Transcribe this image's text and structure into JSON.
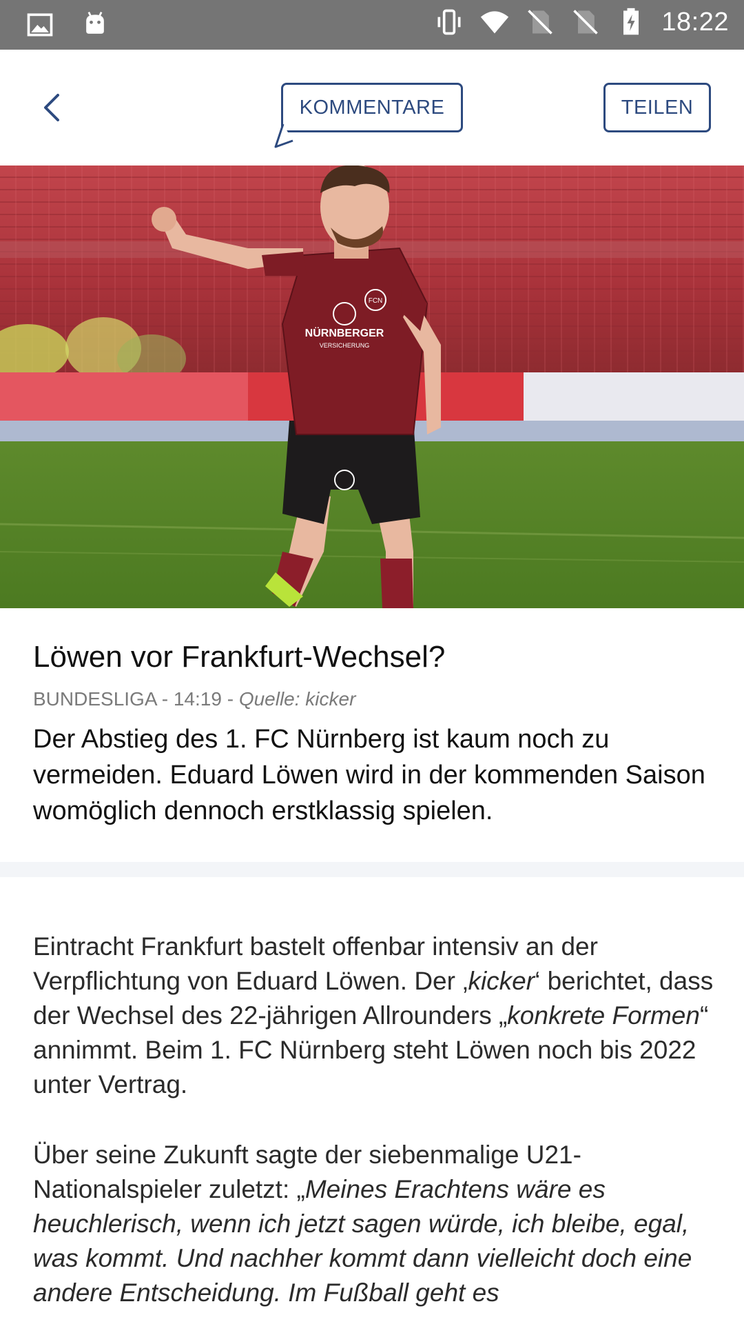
{
  "status_bar": {
    "time": "18:22",
    "left_icons": [
      "image-icon",
      "android-icon"
    ],
    "right_icons": [
      "vibrate-icon",
      "wifi-icon",
      "no-sim-icon",
      "no-sim-icon",
      "battery-charging-icon"
    ]
  },
  "toolbar": {
    "back_icon": "chevron-left-icon",
    "comments_label": "KOMMENTARE",
    "share_label": "TEILEN",
    "accent_color": "#2d4a7f"
  },
  "article": {
    "title": "Löwen vor Frankfurt-Wechsel?",
    "category": "BUNDESLIGA",
    "separator": " - ",
    "time": "14:19",
    "source": "Quelle: kicker",
    "teaser": "Der Abstieg des 1. FC Nürnberg ist kaum noch zu vermeiden. Eduard Löwen wird in der kommenden Saison womöglich dennoch erstklassig spielen.",
    "p1_a": "Eintracht Frankfurt bastelt offenbar intensiv an der Verpflichtung von Eduard Löwen. Der ‚",
    "p1_b": "kicker",
    "p1_c": "‘ berichtet, dass der Wechsel des 22-jährigen Allrounders „",
    "p1_d": "konkrete Formen",
    "p1_e": "“ annimmt. Beim 1. FC Nürnberg steht Löwen noch bis 2022 unter Vertrag.",
    "p2_a": "Über seine Zukunft sagte der siebenmalige U21-Nationalspieler zuletzt: „",
    "p2_b": "Meines Erachtens wäre es heuchlerisch, wenn ich jetzt sagen würde, ich bleibe, egal, was kommt. Und nachher kommt dann vielleicht doch eine andere Entscheidung. Im Fußball geht es"
  },
  "hero_image": {
    "jersey_text": "NÜRNBERGER",
    "jersey_subtext": "VERSICHERUNG",
    "badge_text": "FCN"
  }
}
